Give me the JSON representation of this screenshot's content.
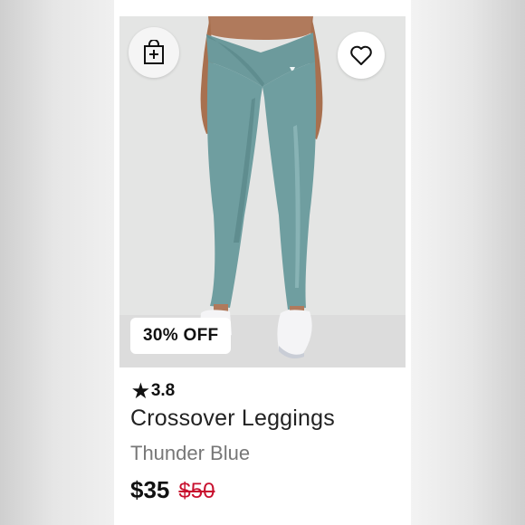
{
  "product": {
    "discount_badge": "30% OFF",
    "rating": "3.8",
    "name": "Crossover Leggings",
    "color": "Thunder Blue",
    "price": "$35",
    "original_price": "$50"
  },
  "icons": {
    "add_to_bag": "shopping-bag-plus-icon",
    "wishlist": "heart-outline-icon",
    "rating": "star-icon"
  },
  "colors": {
    "legging": "#6f9ea0",
    "sale_price": "#c8102e",
    "image_background": "#e4e5e4"
  }
}
